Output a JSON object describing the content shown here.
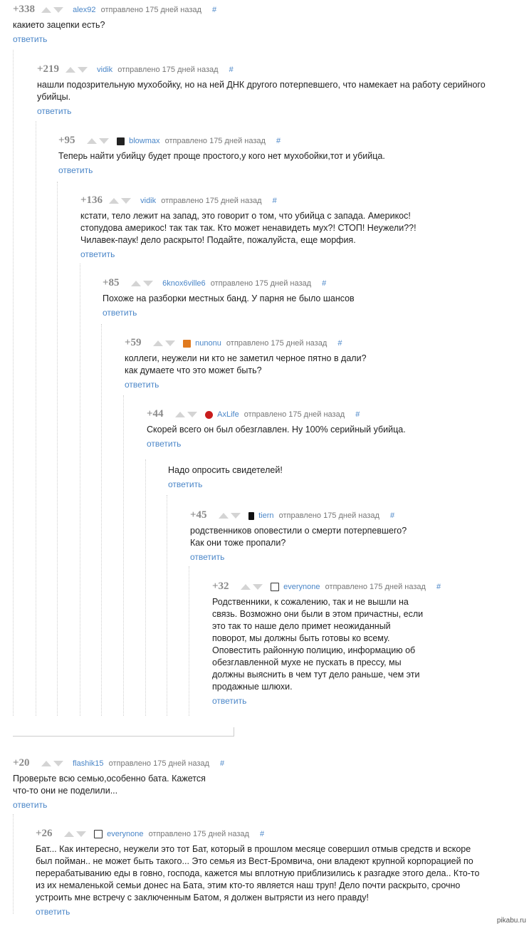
{
  "colors": {
    "link": "#4a86c8",
    "rating": "#8a8a8a",
    "text": "#222222",
    "meta": "#777777"
  },
  "comments": [
    {
      "rating": "+338",
      "author": "alex92",
      "sent": "отправлено 175 дней назад",
      "hash": "#",
      "avatar": "",
      "text": "какието зацепки есть?",
      "reply": "ответить"
    },
    {
      "rating": "+219",
      "author": "vidik",
      "sent": "отправлено 175 дней назад",
      "hash": "#",
      "avatar": "",
      "text": "нашли подозрительную мухобойку, но на ней ДНК другого потерпевшего, что намекает на работу серийного\nубийцы.",
      "reply": "ответить"
    },
    {
      "rating": "+95",
      "author": "blowmax",
      "sent": "отправлено 175 дней назад",
      "hash": "#",
      "avatar": "avatar-dark-icon",
      "text": "Теперь найти убийцу будет проще простого,у кого нет мухобойки,тот и убийца.",
      "reply": "ответить"
    },
    {
      "rating": "+136",
      "author": "vidik",
      "sent": "отправлено 175 дней назад",
      "hash": "#",
      "avatar": "",
      "text": "кстати, тело лежит на запад, это говорит о том, что убийца с запада. Америкос!\nстопудова америкос! так так так. Кто может ненавидеть мух?! СТОП! Неужели??!\nЧилавек-паук! дело раскрыто! Подайте, пожалуйста, еще морфия.",
      "reply": "ответить"
    },
    {
      "rating": "+85",
      "author": "6knox6ville6",
      "sent": "отправлено 175 дней назад",
      "hash": "#",
      "avatar": "",
      "text": "Похоже на разборки местных банд. У парня не было шансов",
      "reply": "ответить"
    },
    {
      "rating": "+59",
      "author": "nunonu",
      "sent": "отправлено 175 дней назад",
      "hash": "#",
      "avatar": "avatar-orange-icon",
      "text": "коллеги, неужели ни кто не заметил черное пятно в дали?\nкак думаете что это может быть?",
      "reply": "ответить"
    },
    {
      "rating": "+44",
      "author": "AxLife",
      "sent": "отправлено 175 дней назад",
      "hash": "#",
      "avatar": "avatar-red-icon",
      "text": "Скорей всего он был обезглавлен. Ну 100% серийный убийца.",
      "reply": "ответить"
    },
    {
      "rating": "",
      "author": "",
      "sent": "",
      "hash": "",
      "avatar": "",
      "text": "Надо опросить свидетелей!",
      "reply": "ответить"
    },
    {
      "rating": "+45",
      "author": "tiern",
      "sent": "отправлено 175 дней назад",
      "hash": "#",
      "avatar": "avatar-black-icon",
      "text": "родственников оповестили о смерти потерпевшего?\nКак они тоже пропали?",
      "reply": "ответить"
    },
    {
      "rating": "+32",
      "author": "everynone",
      "sent": "отправлено 175 дней назад",
      "hash": "#",
      "avatar": "avatar-face-icon",
      "text": "Родственники, к сожалению, так и не вышли на\nсвязь. Возможно они были в этом причастны, если\nэто так то наше дело примет неожиданный\nповорот, мы должны быть готовы ко всему.\nОповестить районную полицию, информацию об\nобезглавленной мухе не пускать в прессу, мы\nдолжны выяснить в чем тут дело раньше, чем эти\nпродажные шлюхи.",
      "reply": "ответить"
    },
    {
      "rating": "+20",
      "author": "flashik15",
      "sent": "отправлено 175 дней назад",
      "hash": "#",
      "avatar": "",
      "text": "Проверьте всю семью,особенно бата. Кажется\nчто-то они не поделили...",
      "reply": "ответить"
    },
    {
      "rating": "+26",
      "author": "everynone",
      "sent": "отправлено 175 дней назад",
      "hash": "#",
      "avatar": "avatar-face-icon",
      "text": "Бат... Как интересно, неужели это тот Бат, который в прошлом месяце совершил отмыв средств и вскоре\nбыл пойман.. не может быть такого... Это семья из Вест-Бромвича, они владеют крупной корпорацией по\nперерабатыванию еды в говно, господа, кажется мы вплотную приблизились к разгадке этого дела.. Кто-то\nиз их немаленькой семьи донес на Бата, этим кто-то является наш труп! Дело почти раскрыто, срочно\nустроить мне встречу с заключенным Батом, я должен вытрясти из него правду!",
      "reply": "ответить"
    }
  ],
  "watermark": "pikabu.ru"
}
